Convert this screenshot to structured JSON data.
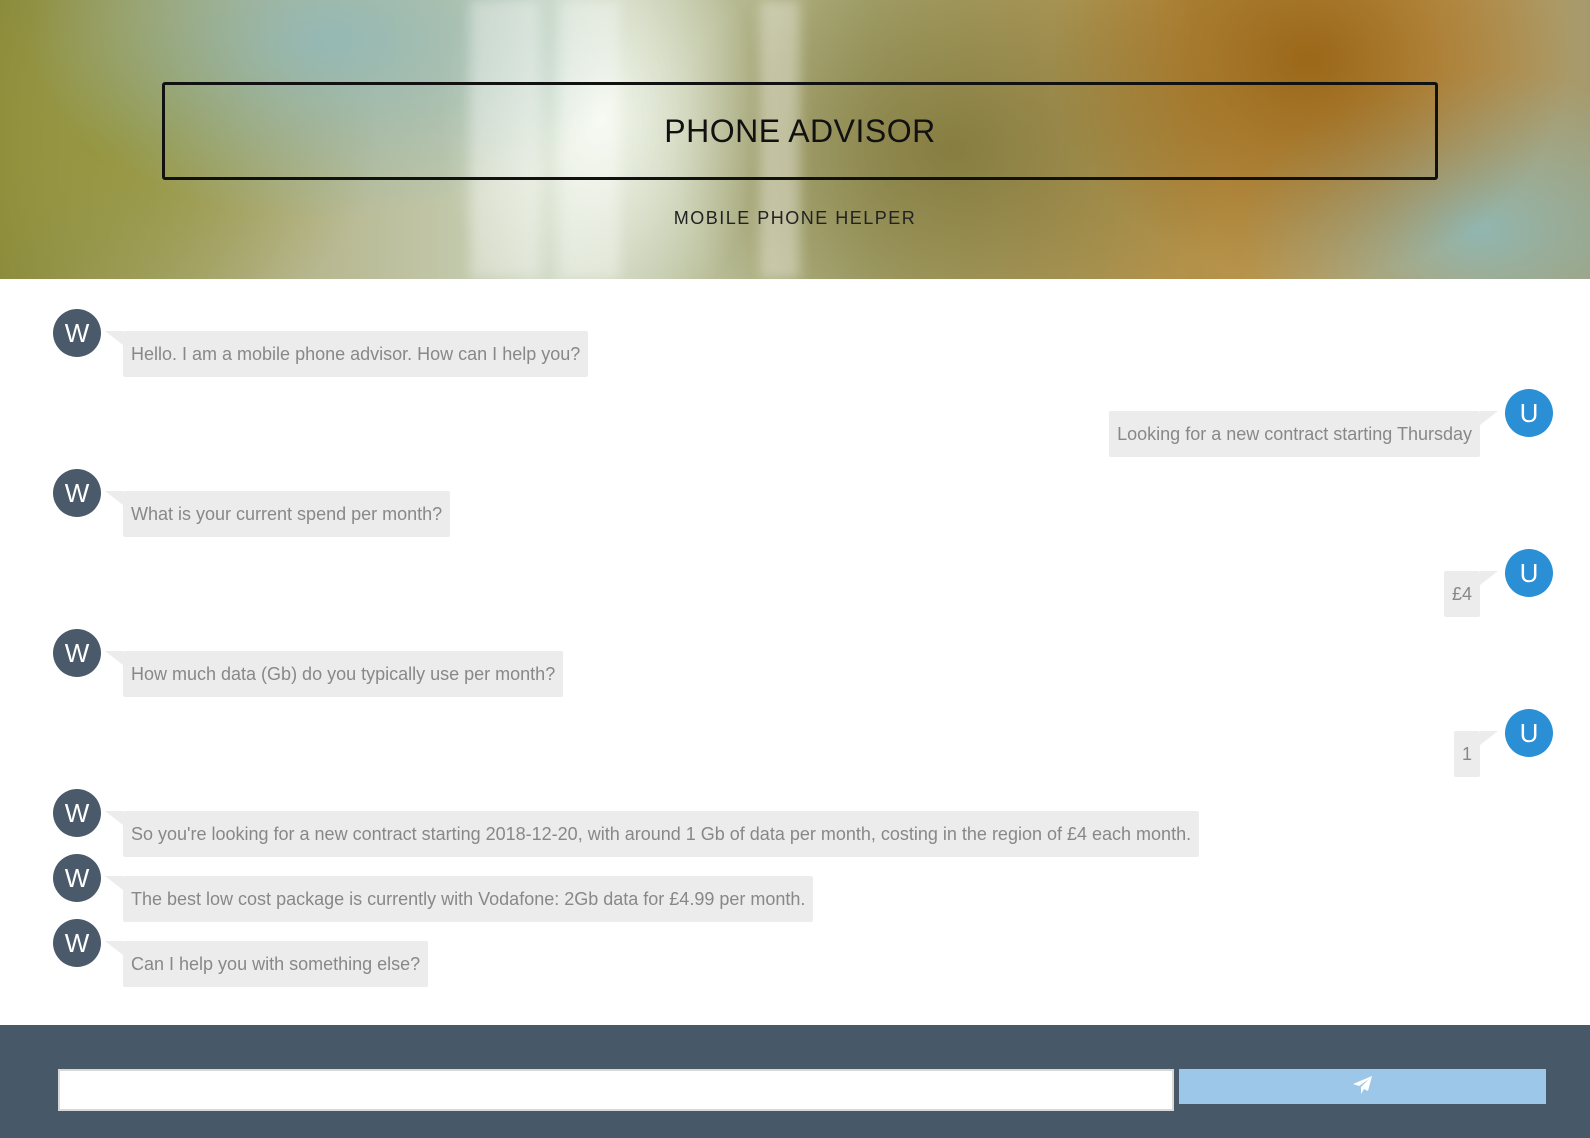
{
  "header": {
    "title": "PHONE ADVISOR",
    "subtitle": "MOBILE PHONE HELPER"
  },
  "messages": [
    {
      "sender": "W",
      "text": "Hello. I am a mobile phone advisor. How can I help you?"
    },
    {
      "sender": "U",
      "text": "Looking for a new contract starting Thursday"
    },
    {
      "sender": "W",
      "text": "What is your current spend per month?"
    },
    {
      "sender": "U",
      "text": "£4"
    },
    {
      "sender": "W",
      "text": "How much data (Gb) do you typically use per month?"
    },
    {
      "sender": "U",
      "text": "1"
    },
    {
      "sender": "W",
      "text": "So you're looking for a new contract starting 2018-12-20, with around 1 Gb of data per month, costing in the region of £4 each month."
    },
    {
      "sender": "W",
      "text": "The best low cost package is currently with Vodafone: 2Gb data for £4.99 per month."
    },
    {
      "sender": "W",
      "text": "Can I help you with something else?"
    }
  ],
  "composer": {
    "input_value": "",
    "send_icon": "paper-plane-icon"
  },
  "colors": {
    "advisor_avatar": "#4a5a6b",
    "user_avatar": "#2b8fd6",
    "bubble": "#ececec",
    "footer": "#475969",
    "send_button": "#9cc7e8"
  }
}
